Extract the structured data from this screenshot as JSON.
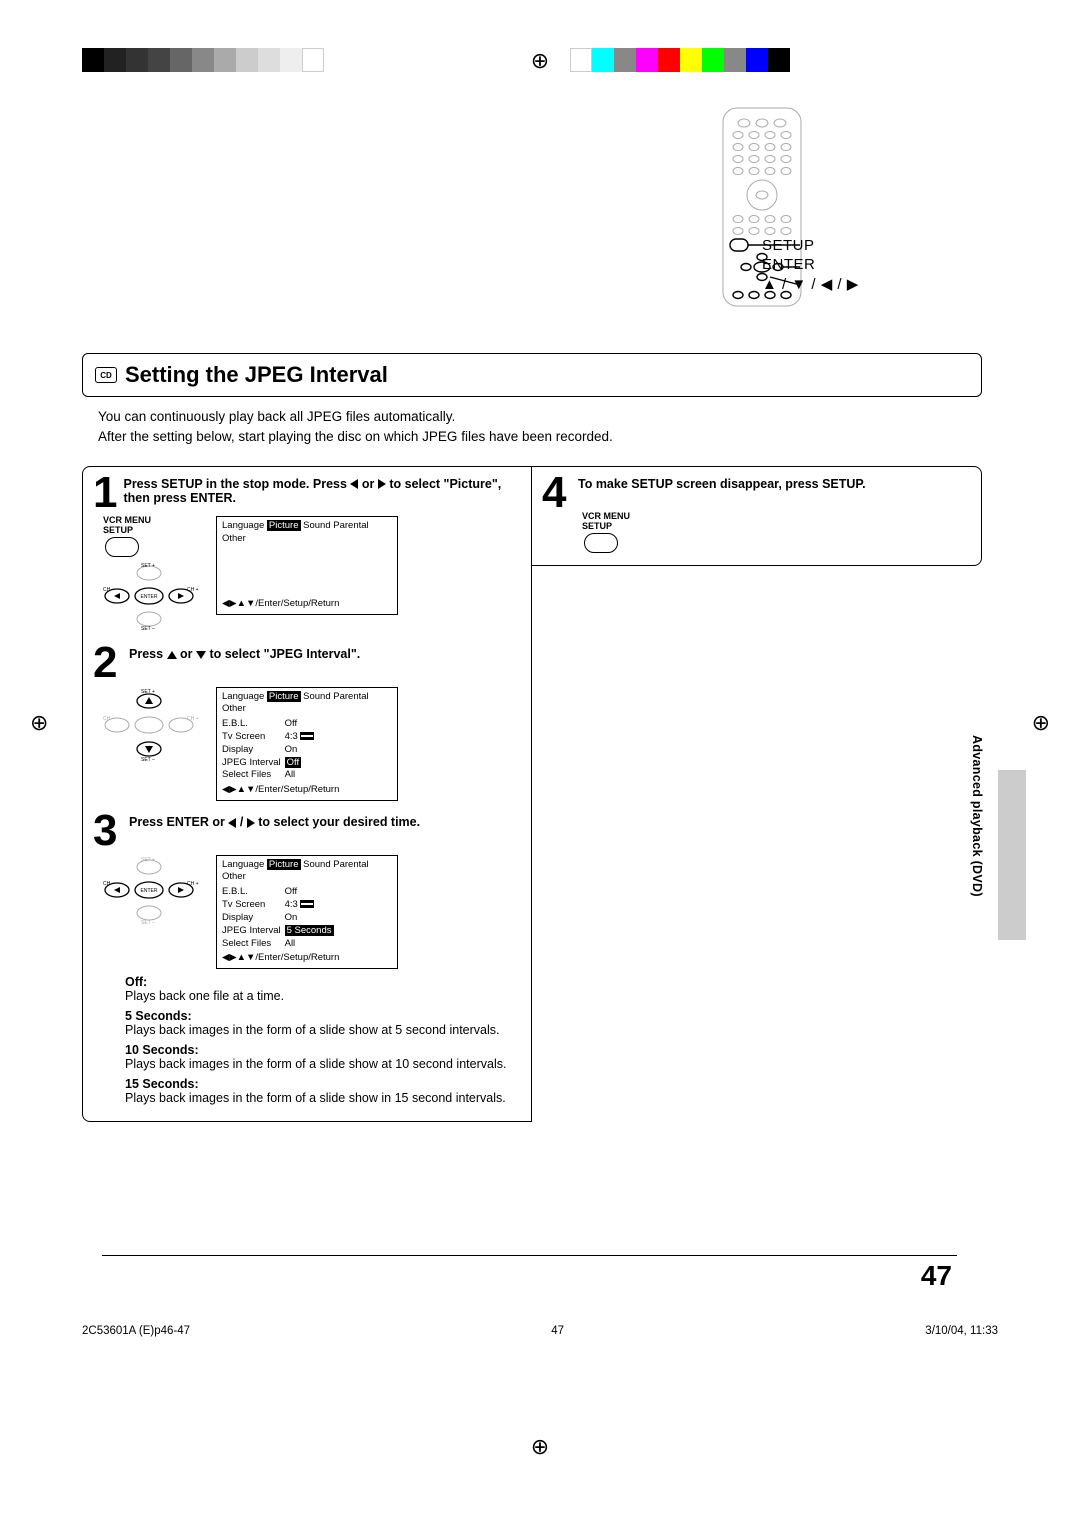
{
  "remote": {
    "label1": "SETUP",
    "label2": "ENTER",
    "label3": "▲ / ▼ / ◀ / ▶"
  },
  "heading": {
    "badge": "CD",
    "title": "Setting the JPEG Interval"
  },
  "intro": {
    "line1": "You can continuously play back all JPEG files automatically.",
    "line2": "After the setting below, start playing the disc on which JPEG files have been recorded."
  },
  "vcr_label_line1": "VCR MENU",
  "vcr_label_line2": "SETUP",
  "osd_tabs": {
    "t1": "Language",
    "t2": "Picture",
    "t3": "Sound",
    "t4": "Parental",
    "t5": "Other"
  },
  "osd_footer": "◀▶▲▼/Enter/Setup/Return",
  "osd_rows": {
    "ebl": "E.B.L.",
    "ebl_v": "Off",
    "tvs": "Tv Screen",
    "tvs_v": "4:3",
    "disp": "Display",
    "disp_v": "On",
    "jpeg": "JPEG Interval",
    "jpeg_off": "Off",
    "jpeg_5s": "5 Seconds",
    "sel": "Select Files",
    "sel_v": "All"
  },
  "steps": {
    "s1": {
      "num": "1",
      "text_a": "Press SETUP in the stop mode. Press ",
      "text_b": " or ",
      "text_c": " to select \"Picture\", then press ENTER."
    },
    "s2": {
      "num": "2",
      "text": "Press ▲ or ▼ to select \"JPEG Interval\"."
    },
    "s3": {
      "num": "3",
      "text": "Press ENTER or ◀ / ▶ to select your desired time."
    },
    "s4": {
      "num": "4",
      "text": "To make SETUP screen disappear, press SETUP."
    }
  },
  "options": {
    "off_l": "Off:",
    "off_t": "Plays back one file at a time.",
    "s5_l": "5 Seconds:",
    "s5_t": "Plays back images in the form of a slide show at 5 second intervals.",
    "s10_l": "10 Seconds:",
    "s10_t": "Plays back images in the form of a slide show at 10 second intervals.",
    "s15_l": "15 Seconds:",
    "s15_t": "Plays back images in the form of a slide show in 15 second intervals."
  },
  "side": "Advanced playback (DVD)",
  "page_number": "47",
  "footer": {
    "left": "2C53601A (E)p46-47",
    "mid": "47",
    "right": "3/10/04, 11:33"
  },
  "colors": {
    "greys": [
      "#000",
      "#222",
      "#333",
      "#444",
      "#666",
      "#888",
      "#aaa",
      "#ccc",
      "#ddd",
      "#eee",
      "#fff"
    ],
    "hues": [
      "#fff",
      "#0ff",
      "#888",
      "#f0f",
      "#f00",
      "#ff0",
      "#0f0",
      "#888",
      "#00f",
      "#000"
    ]
  }
}
